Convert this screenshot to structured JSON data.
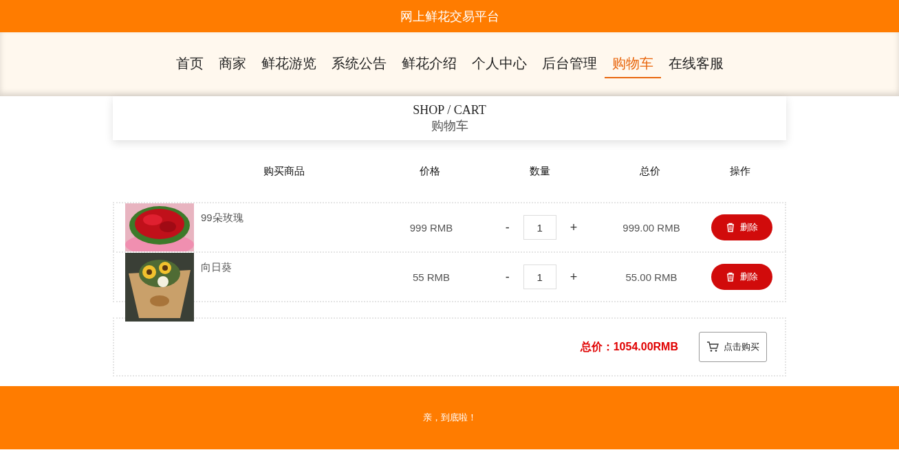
{
  "header": {
    "title": "网上鲜花交易平台"
  },
  "nav": [
    {
      "label": "首页",
      "selected": false
    },
    {
      "label": "商家",
      "selected": false
    },
    {
      "label": "鲜花游览",
      "selected": false
    },
    {
      "label": "系统公告",
      "selected": false
    },
    {
      "label": "鲜花介绍",
      "selected": false
    },
    {
      "label": "个人中心",
      "selected": false
    },
    {
      "label": "后台管理",
      "selected": false
    },
    {
      "label": "购物车",
      "selected": true
    },
    {
      "label": "在线客服",
      "selected": false
    }
  ],
  "section": {
    "title": "SHOP / CART",
    "subtitle": "购物车"
  },
  "table": {
    "columns": [
      "购买商品",
      "价格",
      "数量",
      "总价",
      "操作"
    ],
    "rows": [
      {
        "name": "99朵玫瑰",
        "price": "999 RMB",
        "decrement": "-",
        "quantity": "1",
        "increment": "+",
        "total": "999.00 RMB",
        "delete": "删除"
      },
      {
        "name": "向日葵",
        "price": "55 RMB",
        "decrement": "-",
        "quantity": "1",
        "increment": "+",
        "total": "55.00 RMB",
        "delete": "删除"
      }
    ]
  },
  "summary": {
    "total": "总价：1054.00RMB",
    "buy": "点击购买"
  },
  "footer": {
    "text": "亲，到底啦！"
  }
}
